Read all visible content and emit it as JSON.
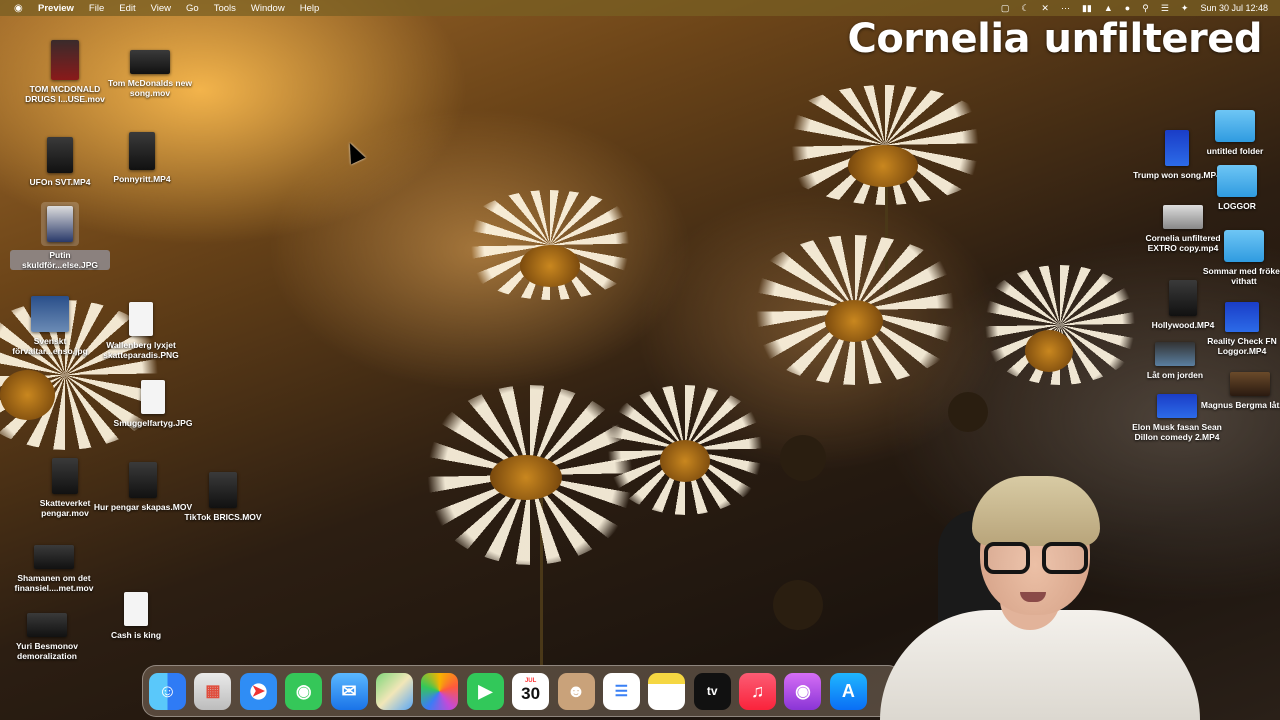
{
  "menubar": {
    "app_name": "Preview",
    "menus": [
      "File",
      "Edit",
      "View",
      "Go",
      "Tools",
      "Window",
      "Help"
    ],
    "clock": "Sun 30 Jul  12:48"
  },
  "overlay_title": "Cornelia unfiltered",
  "desktop": {
    "left_icons": [
      {
        "label": "TOM MCDONALD DRUGS I...USE.mov"
      },
      {
        "label": "Tom McDonalds new song.mov"
      },
      {
        "label": "UFOn SVT.MP4"
      },
      {
        "label": "Ponnyritt.MP4"
      },
      {
        "label": "Putin skuldför...else.JPG"
      },
      {
        "label": "Svenskt förvaltar...enso.jpg"
      },
      {
        "label": "Wallenberg lyxjet skatteparadis.PNG"
      },
      {
        "label": "Smuggelfartyg.JPG"
      },
      {
        "label": "Skatteverket pengar.mov"
      },
      {
        "label": "Hur pengar skapas.MOV"
      },
      {
        "label": "TikTok BRICS.MOV"
      },
      {
        "label": "Shamanen om det finansiel....met.mov"
      },
      {
        "label": "Cash is king"
      },
      {
        "label": "Yuri Besmonov demoralization"
      }
    ],
    "right_icons": [
      {
        "label": "Trump won song.MP4"
      },
      {
        "label": "untitled folder"
      },
      {
        "label": "LOGGOR"
      },
      {
        "label": "Cornelia unfiltered EXTRO copy.mp4"
      },
      {
        "label": "Sommar med fröken vithatt"
      },
      {
        "label": "Hollywood.MP4"
      },
      {
        "label": "Reality Check FN Loggor.MP4"
      },
      {
        "label": "Låt om jorden"
      },
      {
        "label": "Magnus Bergma låt.mov"
      },
      {
        "label": "Elon Musk fasan Sean Dillon comedy 2.MP4"
      }
    ]
  },
  "dock": {
    "items": [
      "Finder",
      "Launchpad",
      "Safari",
      "Messages",
      "Mail",
      "Maps",
      "Photos",
      "FaceTime",
      "Calendar",
      "Contacts",
      "Reminders",
      "Notes",
      "TV",
      "Music",
      "Podcasts",
      "App Store"
    ],
    "calendar_month": "JUL",
    "calendar_day": "30",
    "tv_label": "tv"
  }
}
